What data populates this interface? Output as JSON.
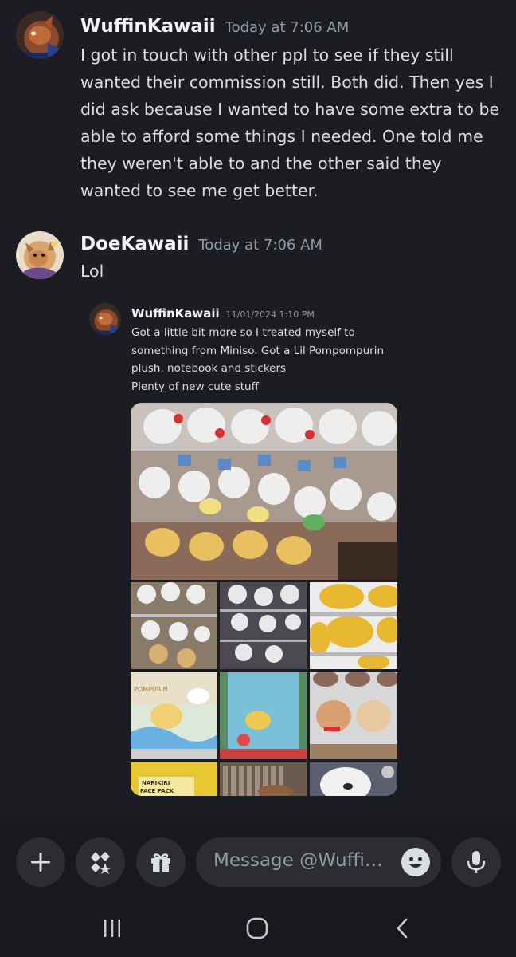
{
  "messages": [
    {
      "author": "WuffinKawaii",
      "timestamp": "Today at 7:06 AM",
      "text": "I got in touch with other ppl to see if they still wanted their commission still. Both did. Then yes I did ask because I wanted to have some extra to be able to afford some things I needed. One told me they weren't able to and the other said they wanted to see me get better."
    },
    {
      "author": "DoeKawaii",
      "timestamp": "Today at 7:06 AM",
      "text": "Lol"
    }
  ],
  "forwarded": {
    "author": "WuffinKawaii",
    "timestamp": "11/01/2024 1:10 PM",
    "text": "Got a little bit more so I treated myself to something from Miniso. Got a Lil Pompompurin plush, notebook and stickers",
    "text2": "Plenty of new cute stuff",
    "photo_labels": {
      "pompurin": "POMPURIN",
      "narikiri": "NARIKIRI",
      "face_pack": "FACE PACK"
    }
  },
  "composer": {
    "placeholder": "Message @Wuffi…"
  },
  "icons": {
    "add": "plus-icon",
    "apps": "apps-icon",
    "gift": "gift-icon",
    "emoji": "emoji-icon",
    "mic": "microphone-icon",
    "recents": "recents-icon",
    "home": "home-icon",
    "back": "back-icon"
  },
  "colors": {
    "background": "#1c1d22",
    "composer_bg": "#18191d",
    "input_bg": "#2b2d31",
    "text": "#dbdee1",
    "muted": "#949ba4"
  }
}
